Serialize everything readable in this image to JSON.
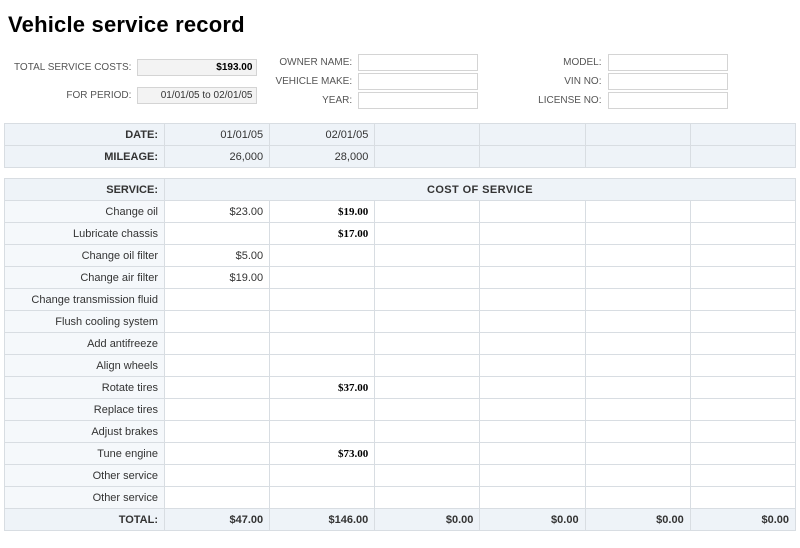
{
  "title": "Vehicle service record",
  "summary": {
    "total_label": "TOTAL SERVICE COSTS:",
    "total_value": "$193.00",
    "period_label": "FOR PERIOD:",
    "period_value": "01/01/05 to 02/01/05"
  },
  "owner_fields": {
    "owner_label": "OWNER NAME:",
    "owner_value": "",
    "make_label": "VEHICLE MAKE:",
    "make_value": "",
    "year_label": "YEAR:",
    "year_value": ""
  },
  "vehicle_fields": {
    "model_label": "MODEL:",
    "model_value": "",
    "vin_label": "VIN NO:",
    "vin_value": "",
    "license_label": "LICENSE NO:",
    "license_value": ""
  },
  "columns": {
    "date_label": "DATE:",
    "mileage_label": "MILEAGE:",
    "dates": [
      "01/01/05",
      "02/01/05",
      "",
      "",
      "",
      ""
    ],
    "mileage": [
      "26,000",
      "28,000",
      "",
      "",
      "",
      ""
    ]
  },
  "service_header": {
    "label": "SERVICE:",
    "cost_title": "COST OF SERVICE"
  },
  "services": [
    {
      "name": "Change oil",
      "costs": [
        "$23.00",
        "$19.00",
        "",
        "",
        "",
        ""
      ],
      "anomaly_cols": [
        1
      ]
    },
    {
      "name": "Lubricate chassis",
      "costs": [
        "",
        "$17.00",
        "",
        "",
        "",
        ""
      ],
      "anomaly_cols": [
        1
      ]
    },
    {
      "name": "Change oil filter",
      "costs": [
        "$5.00",
        "",
        "",
        "",
        "",
        ""
      ],
      "anomaly_cols": []
    },
    {
      "name": "Change air filter",
      "costs": [
        "$19.00",
        "",
        "",
        "",
        "",
        ""
      ],
      "anomaly_cols": []
    },
    {
      "name": "Change transmission fluid",
      "costs": [
        "",
        "",
        "",
        "",
        "",
        ""
      ],
      "anomaly_cols": []
    },
    {
      "name": "Flush cooling system",
      "costs": [
        "",
        "",
        "",
        "",
        "",
        ""
      ],
      "anomaly_cols": []
    },
    {
      "name": "Add antifreeze",
      "costs": [
        "",
        "",
        "",
        "",
        "",
        ""
      ],
      "anomaly_cols": []
    },
    {
      "name": "Align wheels",
      "costs": [
        "",
        "",
        "",
        "",
        "",
        ""
      ],
      "anomaly_cols": []
    },
    {
      "name": "Rotate tires",
      "costs": [
        "",
        "$37.00",
        "",
        "",
        "",
        ""
      ],
      "anomaly_cols": [
        1
      ]
    },
    {
      "name": "Replace tires",
      "costs": [
        "",
        "",
        "",
        "",
        "",
        ""
      ],
      "anomaly_cols": []
    },
    {
      "name": "Adjust brakes",
      "costs": [
        "",
        "",
        "",
        "",
        "",
        ""
      ],
      "anomaly_cols": []
    },
    {
      "name": "Tune engine",
      "costs": [
        "",
        "$73.00",
        "",
        "",
        "",
        ""
      ],
      "anomaly_cols": [
        1
      ]
    },
    {
      "name": "Other service",
      "costs": [
        "",
        "",
        "",
        "",
        "",
        ""
      ],
      "anomaly_cols": []
    },
    {
      "name": "Other service",
      "costs": [
        "",
        "",
        "",
        "",
        "",
        ""
      ],
      "anomaly_cols": []
    }
  ],
  "totals": {
    "label": "TOTAL:",
    "values": [
      "$47.00",
      "$146.00",
      "$0.00",
      "$0.00",
      "$0.00",
      "$0.00"
    ]
  }
}
